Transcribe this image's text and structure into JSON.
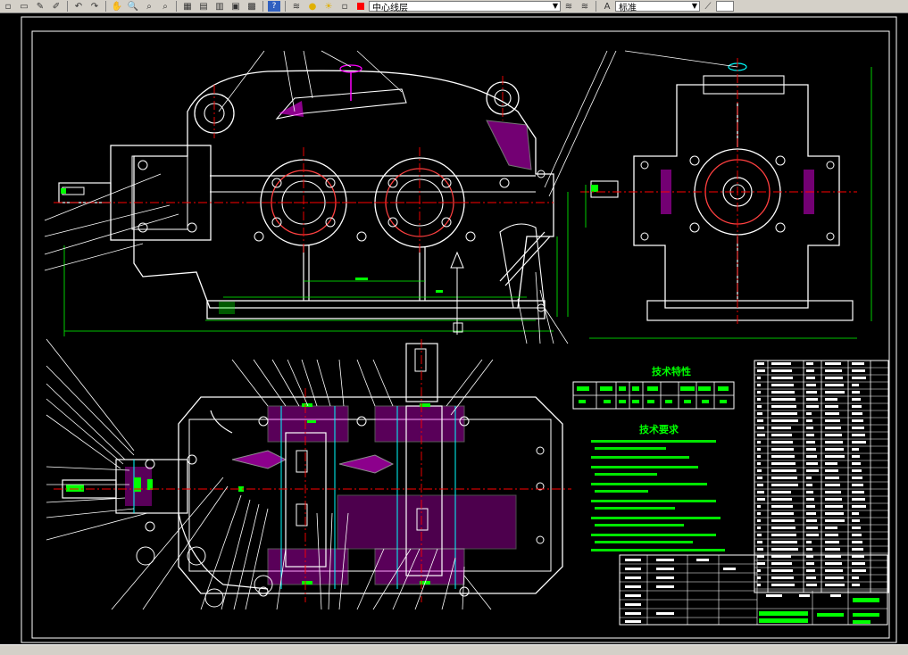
{
  "toolbar": {
    "layer_name": "中心线层",
    "style_name": "标准",
    "layer_color": "#ff0000"
  },
  "drawing": {
    "tech_spec_title": "技术特性",
    "tech_req_title": "技术要求",
    "line_colors": {
      "outline": "#ffffff",
      "center": "#ff0000",
      "hidden": "#00ffff",
      "text": "#00ff00",
      "hatch": "#ff00ff",
      "gear": "#ff6060"
    }
  }
}
